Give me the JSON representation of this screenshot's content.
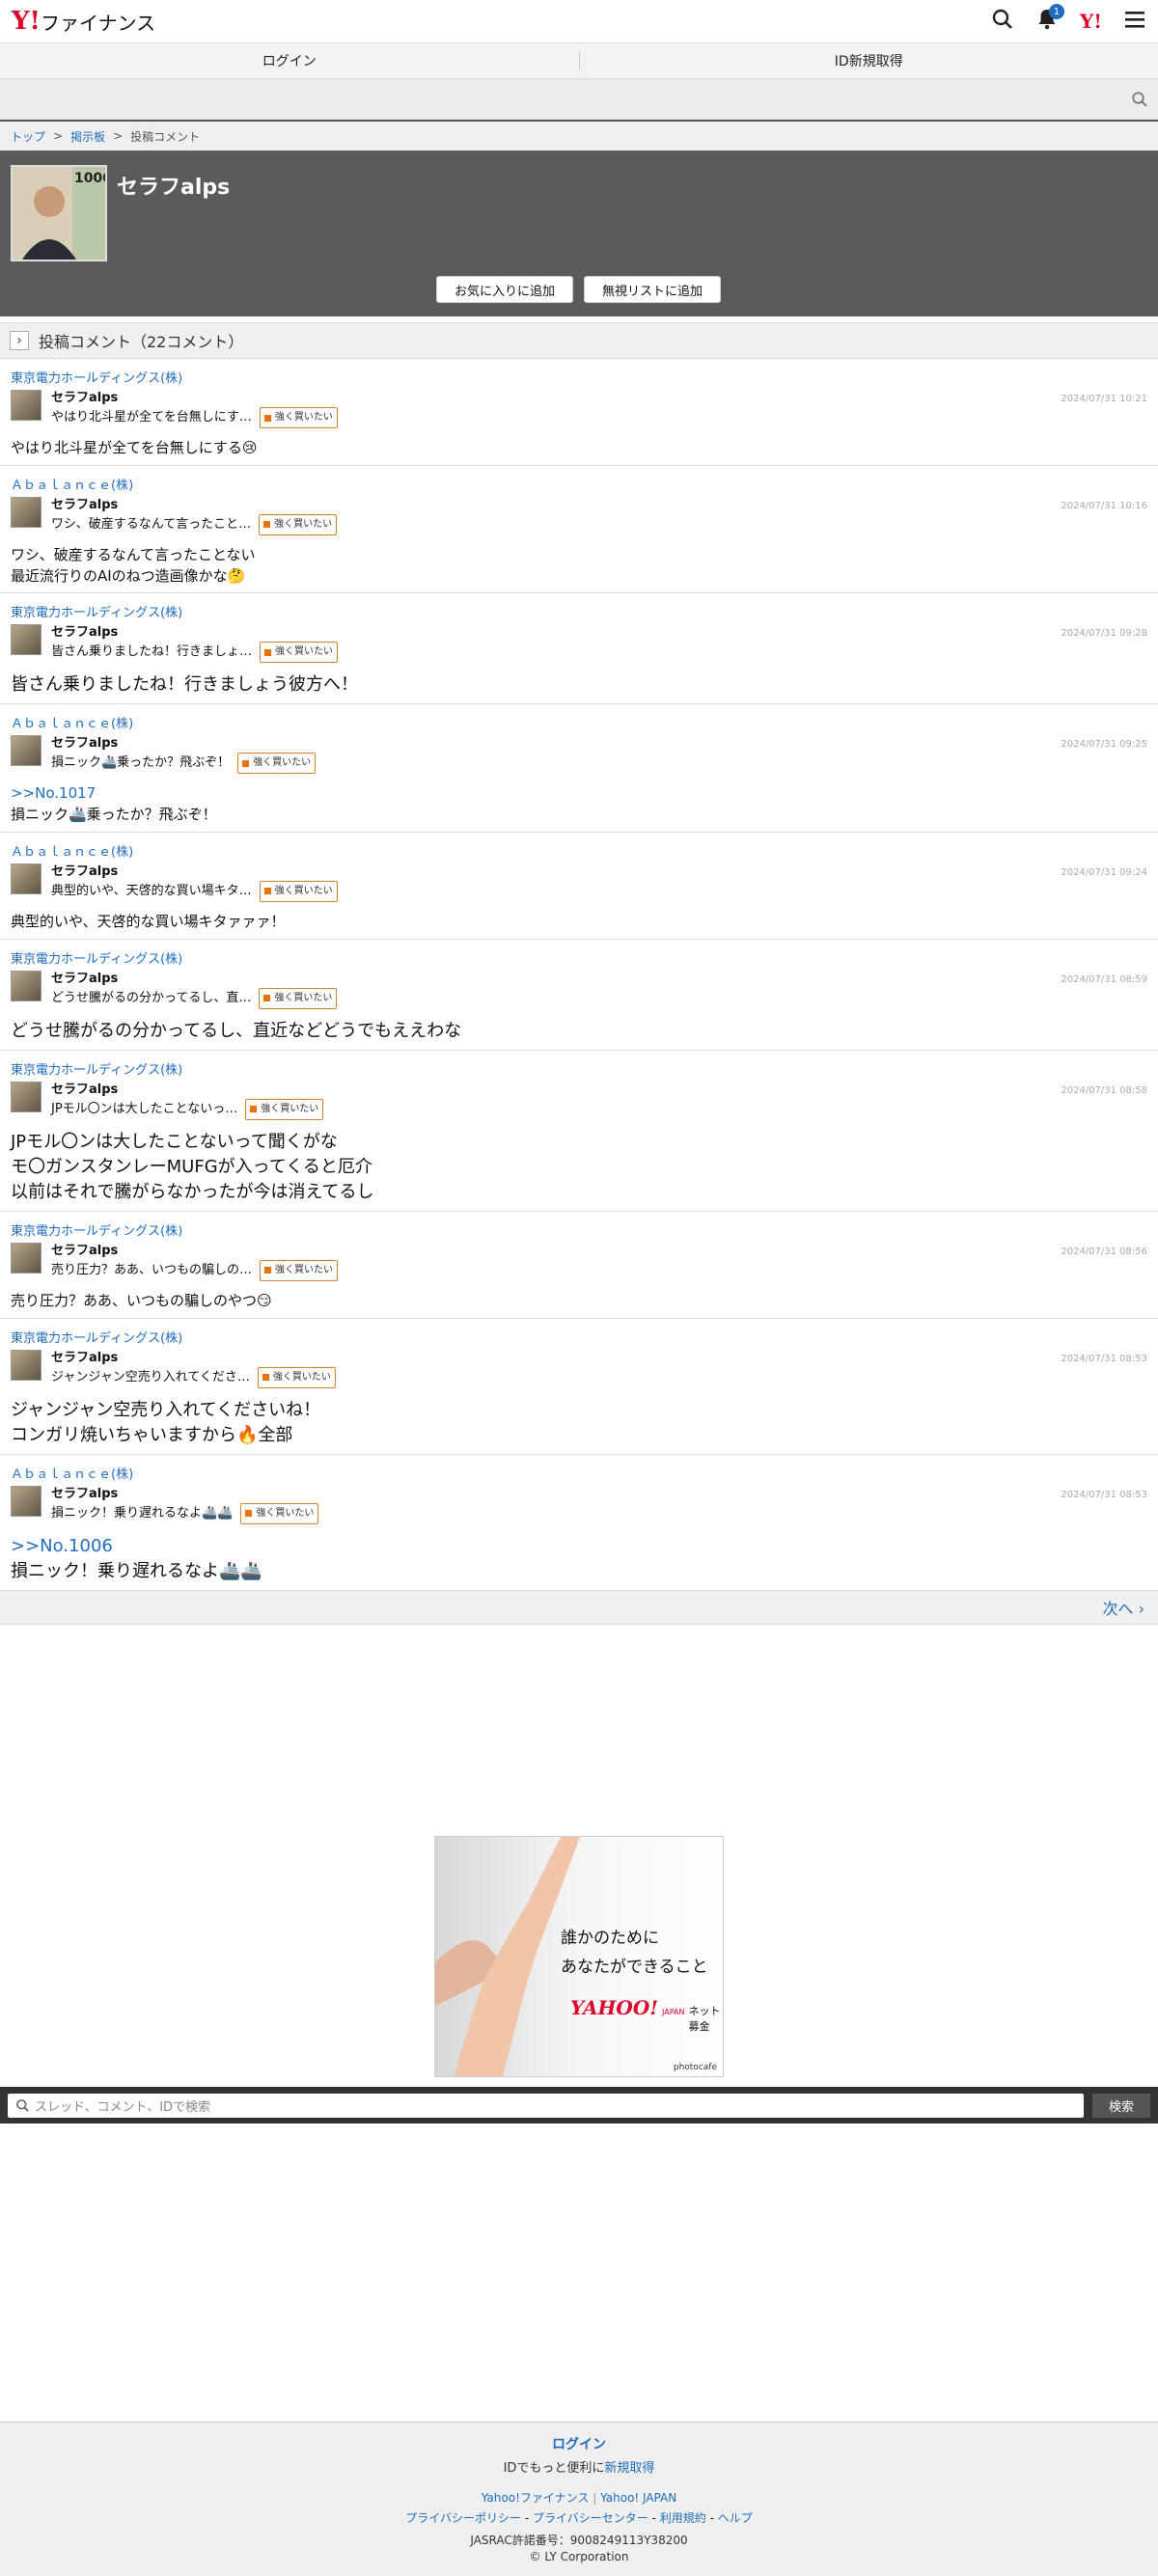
{
  "header": {
    "logo_mark": "Y!",
    "logo_text": "ファイナンス",
    "notif_count": "1",
    "yahoo_mark": "Y!"
  },
  "tabs": {
    "login": "ログイン",
    "signup": "ID新規取得"
  },
  "breadcrumb": {
    "top": "トップ",
    "board": "掲示板",
    "current": "投稿コメント",
    "sep": ">"
  },
  "profile": {
    "name": "セラフalps",
    "fav_button": "お気に入りに追加",
    "ignore_button": "無視リストに追加"
  },
  "section": {
    "title": "投稿コメント（22コメント）"
  },
  "posts": [
    {
      "stock": "東京電力ホールディングス(株)",
      "user": "セラフalps",
      "snippet": "やはり北斗星が全てを台無しにす…",
      "tag": "強く買いたい",
      "date": "2024/07/31 10:21",
      "reply": "",
      "lines": [
        "やはり北斗星が全てを台無しにする😢"
      ]
    },
    {
      "stock": "Ａｂａｌａｎｃｅ(株)",
      "user": "セラフalps",
      "snippet": "ワシ、破産するなんて言ったこと…",
      "tag": "強く買いたい",
      "date": "2024/07/31 10:16",
      "reply": "",
      "lines": [
        "ワシ、破産するなんて言ったことない",
        "最近流行りのAIのねつ造画像かな🤔"
      ]
    },
    {
      "stock": "東京電力ホールディングス(株)",
      "user": "セラフalps",
      "snippet": "皆さん乗りましたね！行きましょ…",
      "tag": "強く買いたい",
      "date": "2024/07/31 09:28",
      "reply": "",
      "lines": [
        "皆さん乗りましたね！行きましょう彼方へ！"
      ]
    },
    {
      "stock": "Ａｂａｌａｎｃｅ(株)",
      "user": "セラフalps",
      "snippet": "損ニック🚢乗ったか？飛ぶぞ！",
      "tag": "強く買いたい",
      "date": "2024/07/31 09:25",
      "reply": ">>No.1017",
      "lines": [
        "損ニック🚢乗ったか？飛ぶぞ！"
      ]
    },
    {
      "stock": "Ａｂａｌａｎｃｅ(株)",
      "user": "セラフalps",
      "snippet": "典型的いや、天啓的な買い場キタ…",
      "tag": "強く買いたい",
      "date": "2024/07/31 09:24",
      "reply": "",
      "lines": [
        "典型的いや、天啓的な買い場キタァァァ！"
      ]
    },
    {
      "stock": "東京電力ホールディングス(株)",
      "user": "セラフalps",
      "snippet": "どうせ騰がるの分かってるし、直…",
      "tag": "強く買いたい",
      "date": "2024/07/31 08:59",
      "reply": "",
      "lines": [
        "どうせ騰がるの分かってるし、直近などどうでもええわな"
      ]
    },
    {
      "stock": "東京電力ホールディングス(株)",
      "user": "セラフalps",
      "snippet": "JPモル〇ンは大したことないっ…",
      "tag": "強く買いたい",
      "date": "2024/07/31 08:58",
      "reply": "",
      "lines": [
        "JPモル〇ンは大したことないって聞くがな",
        "モ〇ガンスタンレーMUFGが入ってくると厄介",
        "以前はそれで騰がらなかったが今は消えてるし"
      ]
    },
    {
      "stock": "東京電力ホールディングス(株)",
      "user": "セラフalps",
      "snippet": "売り圧力？ああ、いつもの騙しの…",
      "tag": "強く買いたい",
      "date": "2024/07/31 08:56",
      "reply": "",
      "lines": [
        "売り圧力？ああ、いつもの騙しのやつ😏"
      ]
    },
    {
      "stock": "東京電力ホールディングス(株)",
      "user": "セラフalps",
      "snippet": "ジャンジャン空売り入れてくださ…",
      "tag": "強く買いたい",
      "date": "2024/07/31 08:53",
      "reply": "",
      "lines": [
        "ジャンジャン空売り入れてくださいね！",
        "コンガリ焼いちゃいますから🔥全部"
      ]
    },
    {
      "stock": "Ａｂａｌａｎｃｅ(株)",
      "user": "セラフalps",
      "snippet": "損ニック！乗り遅れるなよ🚢🚢",
      "tag": "強く買いたい",
      "date": "2024/07/31 08:53",
      "reply": ">>No.1006",
      "lines": [
        "損ニック！乗り遅れるなよ🚢🚢"
      ]
    }
  ],
  "pager": {
    "next": "次へ"
  },
  "ad": {
    "line1": "誰かのために",
    "line2": "あなたができること",
    "brand": "YAHOO!",
    "brand_sub": "JAPAN",
    "service": "ネット募金",
    "credit": "photocafe"
  },
  "search": {
    "placeholder": "スレッド、コメント、IDで検索",
    "button": "検索"
  },
  "footer": {
    "login": "ログイン",
    "prompt_prefix": "IDでもっと便利に",
    "signup": "新規取得",
    "links1": [
      "Yahoo!ファイナンス",
      "Yahoo! JAPAN"
    ],
    "links2": [
      "プライバシーポリシー",
      "プライバシーセンター",
      "利用規約",
      "ヘルプ"
    ],
    "jasrac": "JASRAC許諾番号：9008249113Y38200",
    "copyright": "© LY Corporation"
  }
}
